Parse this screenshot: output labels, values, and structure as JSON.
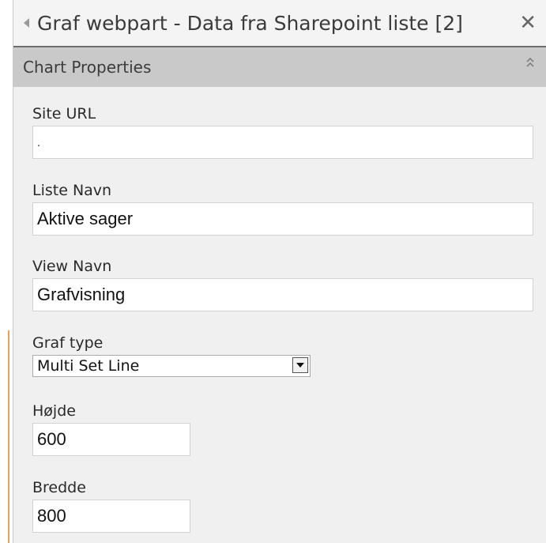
{
  "webpart": {
    "title": "Graf webpart - Data fra Sharepoint liste [2]",
    "close_glyph": "✕"
  },
  "section": {
    "title": "Chart Properties",
    "collapse_glyph": "⌃\n⌃"
  },
  "fields": {
    "site_url": {
      "label": "Site URL",
      "value": "."
    },
    "liste_navn": {
      "label": "Liste Navn",
      "value": "Aktive sager"
    },
    "view_navn": {
      "label": "View Navn",
      "value": "Grafvisning"
    },
    "graf_type": {
      "label": "Graf type",
      "value": "Multi Set Line"
    },
    "hojde": {
      "label": "Højde",
      "value": "600"
    },
    "bredde": {
      "label": "Bredde",
      "value": "800"
    }
  },
  "icons": {
    "collapse": "left-triangle-icon",
    "close": "close-icon",
    "section_toggle": "double-chevron-up-icon",
    "dropdown": "dropdown-arrow-icon"
  },
  "colors": {
    "panel_bg": "#f0f0f0",
    "section_header_bg": "#c9c9c9",
    "accent_orange": "#e8a15a"
  }
}
